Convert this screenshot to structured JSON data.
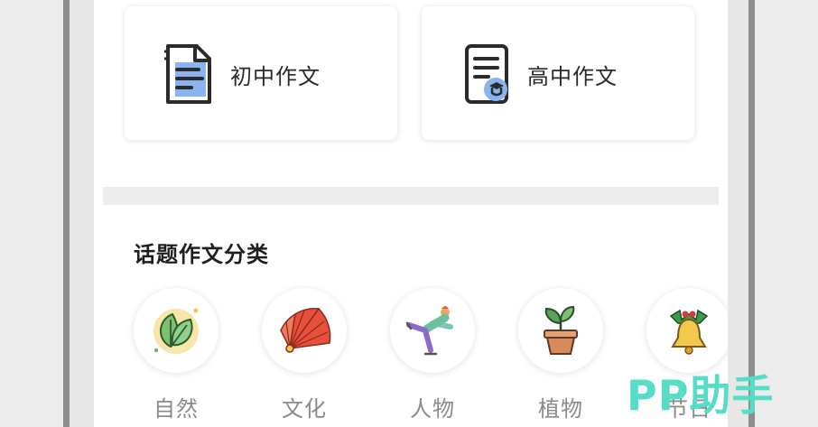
{
  "cards": [
    {
      "label": "初中作文",
      "icon": "document-lines-icon"
    },
    {
      "label": "高中作文",
      "icon": "document-graduate-icon"
    }
  ],
  "section": {
    "title": "话题作文分类"
  },
  "categories": [
    {
      "label": "自然",
      "icon": "leaf-icon"
    },
    {
      "label": "文化",
      "icon": "folding-fan-icon"
    },
    {
      "label": "人物",
      "icon": "skater-icon"
    },
    {
      "label": "植物",
      "icon": "potted-plant-icon"
    },
    {
      "label": "节日",
      "icon": "christmas-bell-icon"
    }
  ],
  "watermark": "PP助手",
  "colors": {
    "accent_blue": "#8ab4f0",
    "watermark": "#55ddc8",
    "label_gray": "#8a8a8a"
  }
}
